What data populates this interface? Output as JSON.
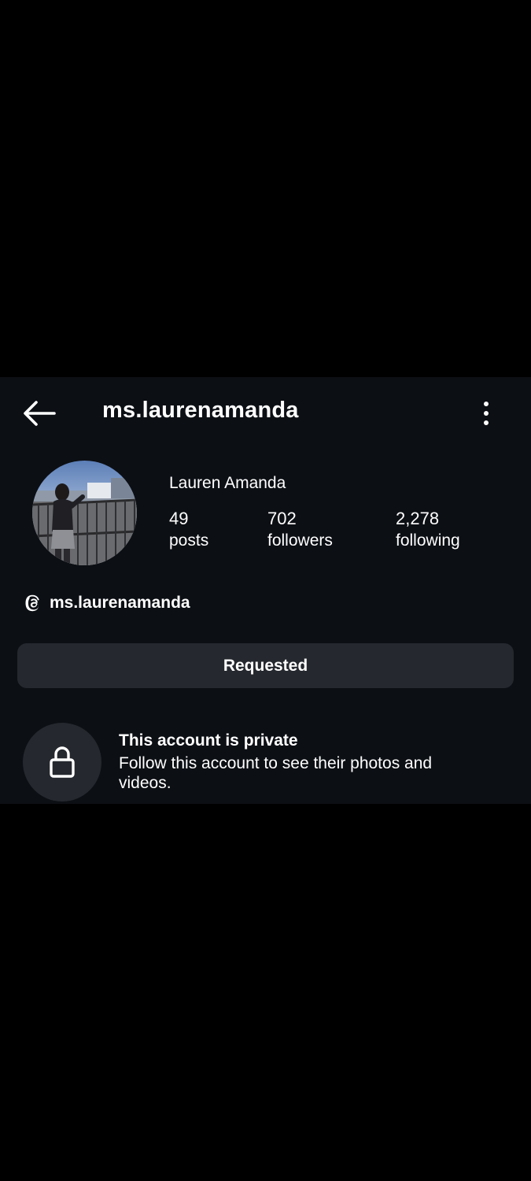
{
  "header": {
    "username": "ms.laurenamanda"
  },
  "profile": {
    "display_name": "Lauren Amanda",
    "stats": [
      {
        "value": "49",
        "label": "posts"
      },
      {
        "value": "702",
        "label": "followers"
      },
      {
        "value": "2,278",
        "label": "following"
      }
    ],
    "threads_handle": "ms.laurenamanda"
  },
  "actions": {
    "follow_status_label": "Requested"
  },
  "private_notice": {
    "title": "This account is private",
    "description": "Follow this account to see their photos and videos."
  },
  "colors": {
    "page_background": "#000000",
    "screen_background": "#0c0f14",
    "button_background": "#25282e",
    "text": "#ffffff"
  },
  "icons": {
    "back": "arrow-left-icon",
    "more": "more-vertical-icon",
    "threads": "threads-icon",
    "lock": "lock-icon"
  }
}
